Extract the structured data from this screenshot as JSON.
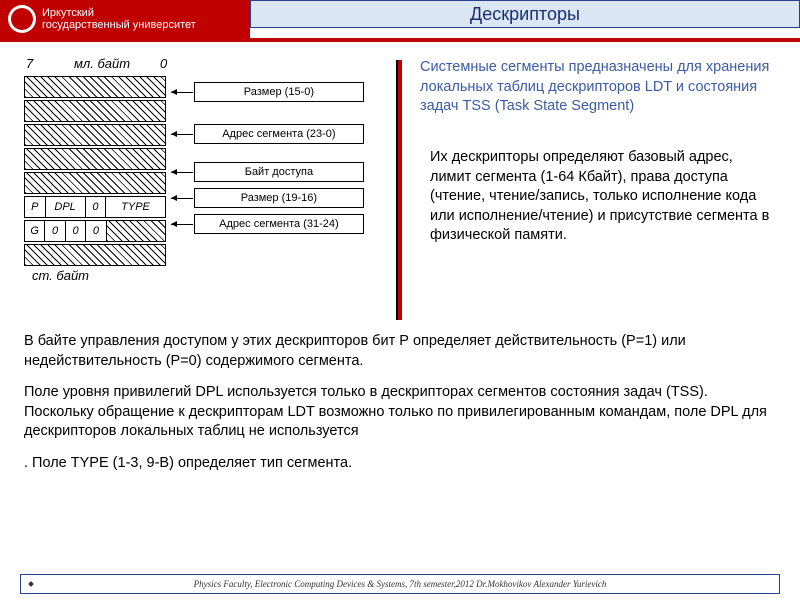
{
  "header": {
    "university_line1": "Иркутский",
    "university_line2": "государственный университет",
    "title": "Дескрипторы"
  },
  "diagram": {
    "bit7": "7",
    "ml_byte": "мл. байт",
    "bit0": "0",
    "st_byte": "ст. байт",
    "labels": {
      "size": "Размер (15-0)",
      "addr1": "Адрес сегмента (23-0)",
      "access": "Байт доступа",
      "size2": "Размер (19-16)",
      "addr2": "Адрес сегмента (31-24)"
    },
    "bits": {
      "r1": [
        "P",
        "DPL",
        "0",
        "TYPE"
      ],
      "r2": [
        "G",
        "0",
        "0",
        "0"
      ]
    }
  },
  "text": {
    "p1": "Системные сегменты предназначены для хранения локальных таблиц дескрипторов LDT и состояния задач TSS (Task State Segment)",
    "p2": "Их дескрипторы определяют базовый адрес, лимит сегмента (1-64 Кбайт), права доступа (чтение, чтение/запись, только исполнение кода или исполнение/чтение) и присутствие сегмента в физической памяти.",
    "p3": "В байте управления доступом у этих дескрипторов бит Р определяет действительность (Р=1) или недействительность (Р=0) содержимого сегмента.",
    "p4": "Поле уровня привилегий DPL используется только в дескрипторах сегментов состояния задач (TSS). Поскольку обращение к дескрипторам LDT возможно только по привилегированным командам, поле DPL для дескрипторов локальных таблиц не используется",
    "p5": ". Поле TYPE (1-3, 9-B) определяет тип сегмента."
  },
  "footer": "Physics Faculty, Electronic Computing Devices & Systems, 7th semester,2012 Dr.Mokhovikov Alexander Yurievich"
}
